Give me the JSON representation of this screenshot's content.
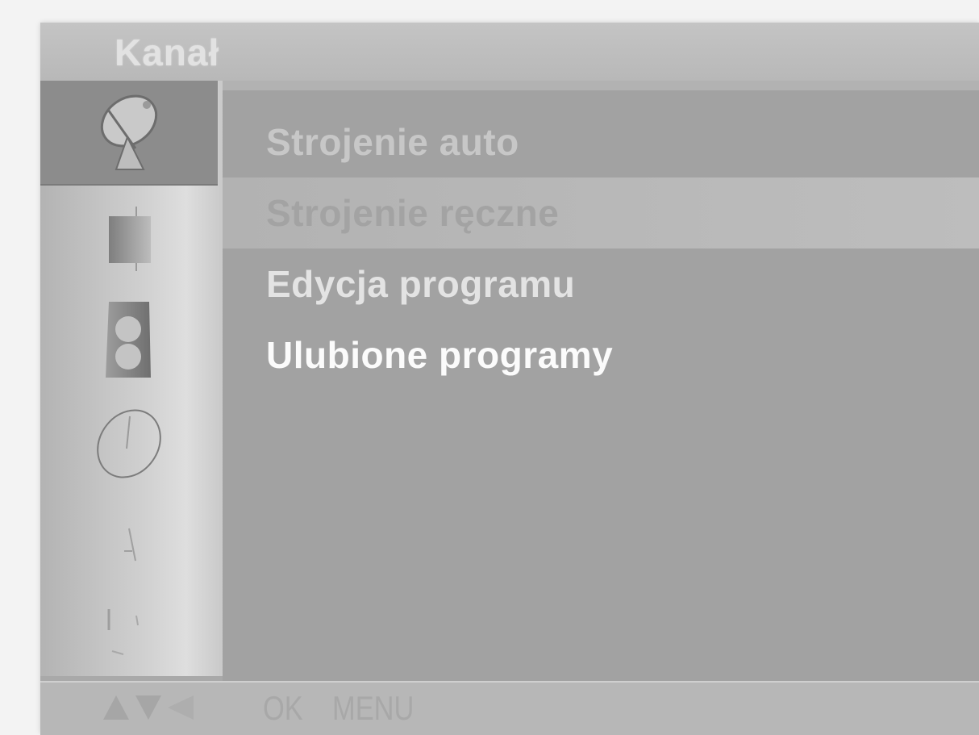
{
  "menu": {
    "title": "Kanał",
    "items": [
      {
        "label": "Strojenie auto",
        "color": "#c7c7c7"
      },
      {
        "label": "Strojenie ręczne",
        "color": "#a3a3a3"
      },
      {
        "label": "Edycja programu",
        "color": "#e3e3e3"
      },
      {
        "label": "Ulubione programy",
        "color": "#fbfbfb"
      }
    ],
    "selected_index": 1
  },
  "sidebar": {
    "icons": [
      {
        "name": "satellite-dish-icon",
        "selected": true
      },
      {
        "name": "picture-icon",
        "selected": false
      },
      {
        "name": "audio-speaker-icon",
        "selected": false
      },
      {
        "name": "clock-icon",
        "selected": false
      },
      {
        "name": "lock-icon",
        "selected": false
      },
      {
        "name": "input-icon",
        "selected": false
      }
    ]
  },
  "footer": {
    "ok_label": "OK",
    "menu_label": "MENU"
  },
  "colors": {
    "panel_bg": "#a9a9a9",
    "title_text": "#e2e2e2",
    "sidebar_selected": "#8c8c8c"
  }
}
